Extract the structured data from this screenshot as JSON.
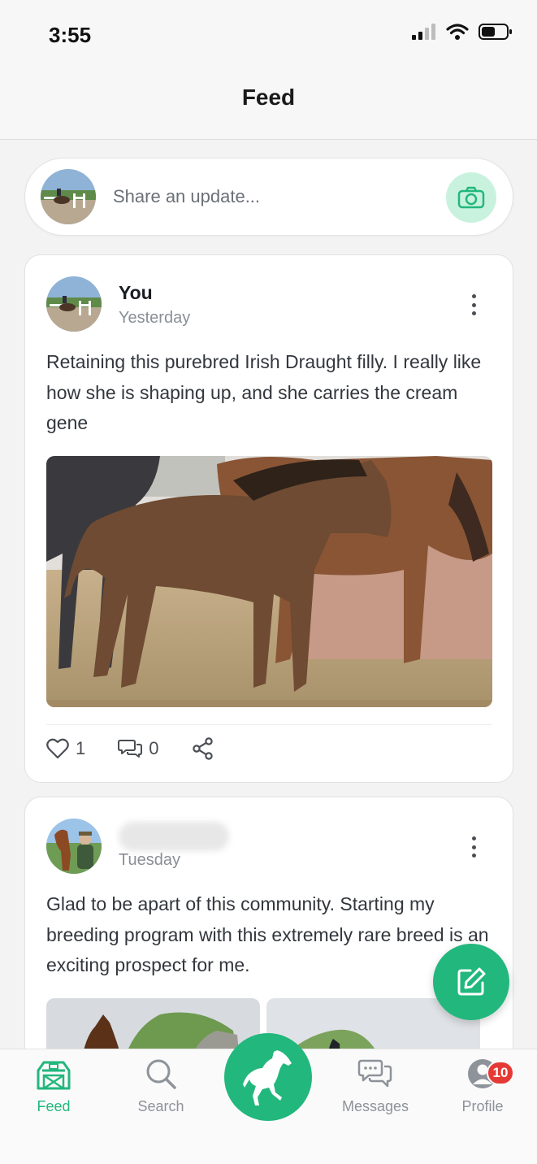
{
  "status_bar": {
    "time": "3:55"
  },
  "header": {
    "title": "Feed"
  },
  "composer": {
    "placeholder": "Share an update..."
  },
  "posts": [
    {
      "author": "You",
      "time": "Yesterday",
      "text": "Retaining this purebred Irish Draught filly. I really like how she is shaping up, and she carries the cream gene",
      "likes": "1",
      "comments": "0"
    },
    {
      "author": "",
      "time": "Tuesday",
      "text": "Glad to be apart of this community. Starting my breeding program with this extremely rare breed is an exciting prospect for me."
    }
  ],
  "tabs": [
    {
      "label": "Feed",
      "icon": "barn-icon",
      "active": true
    },
    {
      "label": "Search",
      "icon": "search-icon"
    },
    {
      "label": "Messages",
      "icon": "chat-bubbles-icon"
    },
    {
      "label": "Profile",
      "icon": "user-icon",
      "badge": "10"
    }
  ],
  "colors": {
    "accent": "#22b77d",
    "badge": "#e53935"
  }
}
